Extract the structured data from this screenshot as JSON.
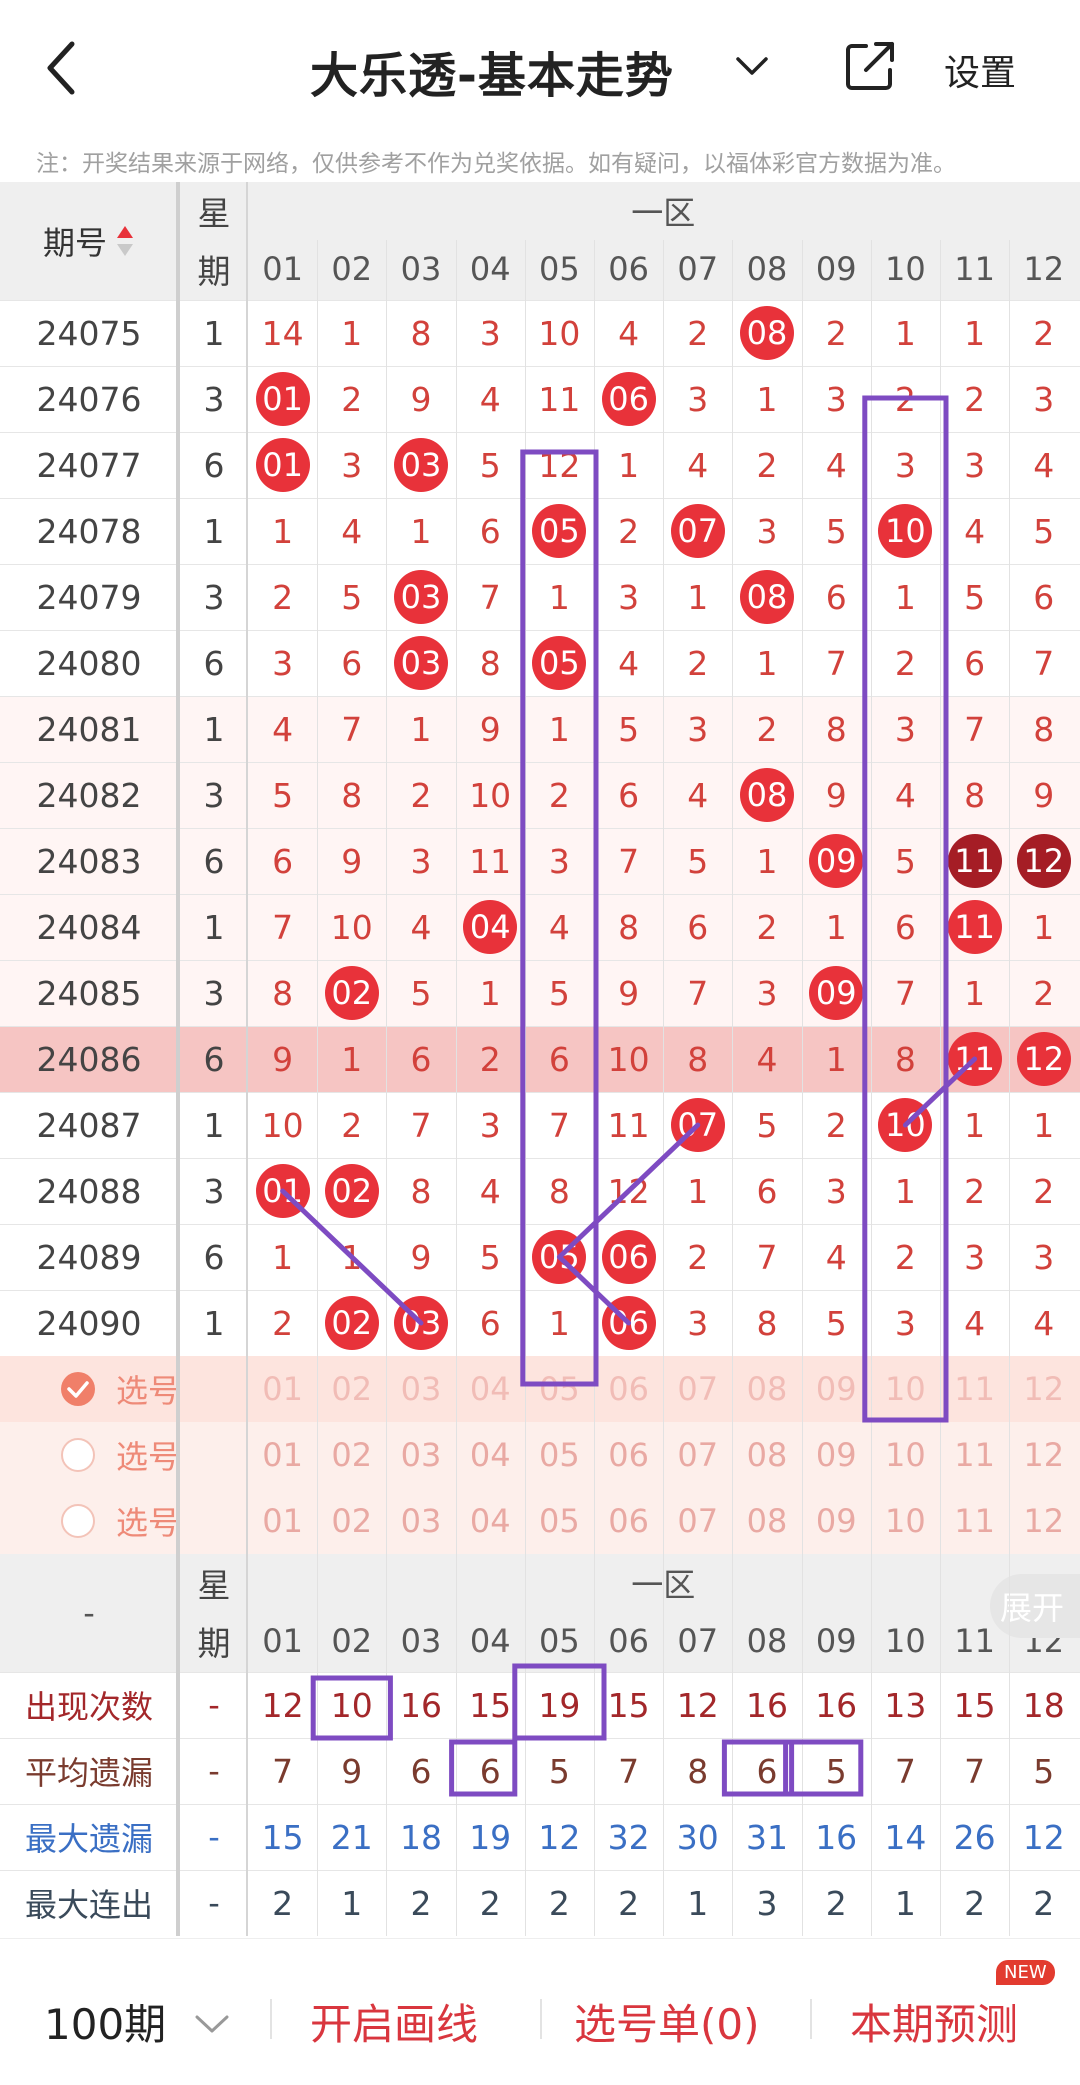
{
  "header": {
    "title": "大乐透-基本走势",
    "settings_label": "设置"
  },
  "notice": "注：开奖结果来源于网络，仅供参考不作为兑奖依据。如有疑问，以福体彩官方数据为准。",
  "table_header": {
    "issue_label": "期号",
    "week_label_top": "星",
    "week_label_bottom": "期",
    "zone_label": "一区",
    "columns": [
      "01",
      "02",
      "03",
      "04",
      "05",
      "06",
      "07",
      "08",
      "09",
      "10",
      "11",
      "12"
    ]
  },
  "rows": [
    {
      "issue": "24075",
      "week": "1",
      "cells": [
        "14",
        "1",
        "8",
        "3",
        "10",
        "4",
        "2",
        "08",
        "2",
        "1",
        "1",
        "2"
      ],
      "balls": [
        7
      ]
    },
    {
      "issue": "24076",
      "week": "3",
      "cells": [
        "01",
        "2",
        "9",
        "4",
        "11",
        "06",
        "3",
        "1",
        "3",
        "2",
        "2",
        "3"
      ],
      "balls": [
        0,
        5
      ]
    },
    {
      "issue": "24077",
      "week": "6",
      "cells": [
        "01",
        "3",
        "03",
        "5",
        "12",
        "1",
        "4",
        "2",
        "4",
        "3",
        "3",
        "4"
      ],
      "balls": [
        0,
        2
      ]
    },
    {
      "issue": "24078",
      "week": "1",
      "cells": [
        "1",
        "4",
        "1",
        "6",
        "05",
        "2",
        "07",
        "3",
        "5",
        "10",
        "4",
        "5"
      ],
      "balls": [
        4,
        6,
        9
      ]
    },
    {
      "issue": "24079",
      "week": "3",
      "cells": [
        "2",
        "5",
        "03",
        "7",
        "1",
        "3",
        "1",
        "08",
        "6",
        "1",
        "5",
        "6"
      ],
      "balls": [
        2,
        7
      ]
    },
    {
      "issue": "24080",
      "week": "6",
      "cells": [
        "3",
        "6",
        "03",
        "8",
        "05",
        "4",
        "2",
        "1",
        "7",
        "2",
        "6",
        "7"
      ],
      "balls": [
        2,
        4
      ]
    },
    {
      "issue": "24081",
      "week": "1",
      "cells": [
        "4",
        "7",
        "1",
        "9",
        "1",
        "5",
        "3",
        "2",
        "8",
        "3",
        "7",
        "8"
      ],
      "balls": []
    },
    {
      "issue": "24082",
      "week": "3",
      "cells": [
        "5",
        "8",
        "2",
        "10",
        "2",
        "6",
        "4",
        "08",
        "9",
        "4",
        "8",
        "9"
      ],
      "balls": [
        7
      ]
    },
    {
      "issue": "24083",
      "week": "6",
      "cells": [
        "6",
        "9",
        "3",
        "11",
        "3",
        "7",
        "5",
        "1",
        "09",
        "5",
        "11",
        "12"
      ],
      "balls": [
        8,
        10,
        11
      ],
      "dark": [
        10,
        11
      ]
    },
    {
      "issue": "24084",
      "week": "1",
      "cells": [
        "7",
        "10",
        "4",
        "04",
        "4",
        "8",
        "6",
        "2",
        "1",
        "6",
        "11",
        "1"
      ],
      "balls": [
        3,
        10
      ]
    },
    {
      "issue": "24085",
      "week": "3",
      "cells": [
        "8",
        "02",
        "5",
        "1",
        "5",
        "9",
        "7",
        "3",
        "09",
        "7",
        "1",
        "2"
      ],
      "balls": [
        1,
        8
      ]
    },
    {
      "issue": "24086",
      "week": "6",
      "cells": [
        "9",
        "1",
        "6",
        "2",
        "6",
        "10",
        "8",
        "4",
        "1",
        "8",
        "11",
        "12"
      ],
      "balls": [
        10,
        11
      ],
      "highlight": true
    },
    {
      "issue": "24087",
      "week": "1",
      "cells": [
        "10",
        "2",
        "7",
        "3",
        "7",
        "11",
        "07",
        "5",
        "2",
        "10",
        "1",
        "1"
      ],
      "balls": [
        6,
        9
      ]
    },
    {
      "issue": "24088",
      "week": "3",
      "cells": [
        "01",
        "02",
        "8",
        "4",
        "8",
        "12",
        "1",
        "6",
        "3",
        "1",
        "2",
        "2"
      ],
      "balls": [
        0,
        1
      ]
    },
    {
      "issue": "24089",
      "week": "6",
      "cells": [
        "1",
        "1",
        "9",
        "5",
        "05",
        "06",
        "2",
        "7",
        "4",
        "2",
        "3",
        "3"
      ],
      "balls": [
        4,
        5
      ]
    },
    {
      "issue": "24090",
      "week": "1",
      "cells": [
        "2",
        "02",
        "03",
        "6",
        "1",
        "06",
        "3",
        "8",
        "5",
        "3",
        "4",
        "4"
      ],
      "balls": [
        1,
        2,
        5
      ]
    }
  ],
  "pick_rows": [
    {
      "label": "选号",
      "checked": true
    },
    {
      "label": "选号",
      "checked": false
    },
    {
      "label": "选号",
      "checked": false
    }
  ],
  "pick_numbers": [
    "01",
    "02",
    "03",
    "04",
    "05",
    "06",
    "07",
    "08",
    "09",
    "10",
    "11",
    "12"
  ],
  "stats_header": {
    "dash": "-",
    "expand_label": "展开"
  },
  "stats": [
    {
      "label": "出现次数",
      "dash": "-",
      "values": [
        "12",
        "10",
        "16",
        "15",
        "19",
        "15",
        "12",
        "16",
        "16",
        "13",
        "15",
        "18"
      ],
      "color": "#a3272a"
    },
    {
      "label": "平均遗漏",
      "dash": "-",
      "values": [
        "7",
        "9",
        "6",
        "6",
        "5",
        "7",
        "8",
        "6",
        "5",
        "7",
        "7",
        "5"
      ],
      "color": "#7a3b2e"
    },
    {
      "label": "最大遗漏",
      "dash": "-",
      "values": [
        "15",
        "21",
        "18",
        "19",
        "12",
        "32",
        "30",
        "31",
        "16",
        "14",
        "26",
        "12"
      ],
      "color": "#3a6fc4"
    },
    {
      "label": "最大连出",
      "dash": "-",
      "values": [
        "2",
        "1",
        "2",
        "2",
        "2",
        "2",
        "1",
        "3",
        "2",
        "1",
        "2",
        "2"
      ],
      "color": "#3a4a5a"
    }
  ],
  "bottom": {
    "period": "100期",
    "draw_line": "开启画线",
    "pick_list": "选号单(0)",
    "predict": "本期预测",
    "new_badge": "NEW"
  }
}
